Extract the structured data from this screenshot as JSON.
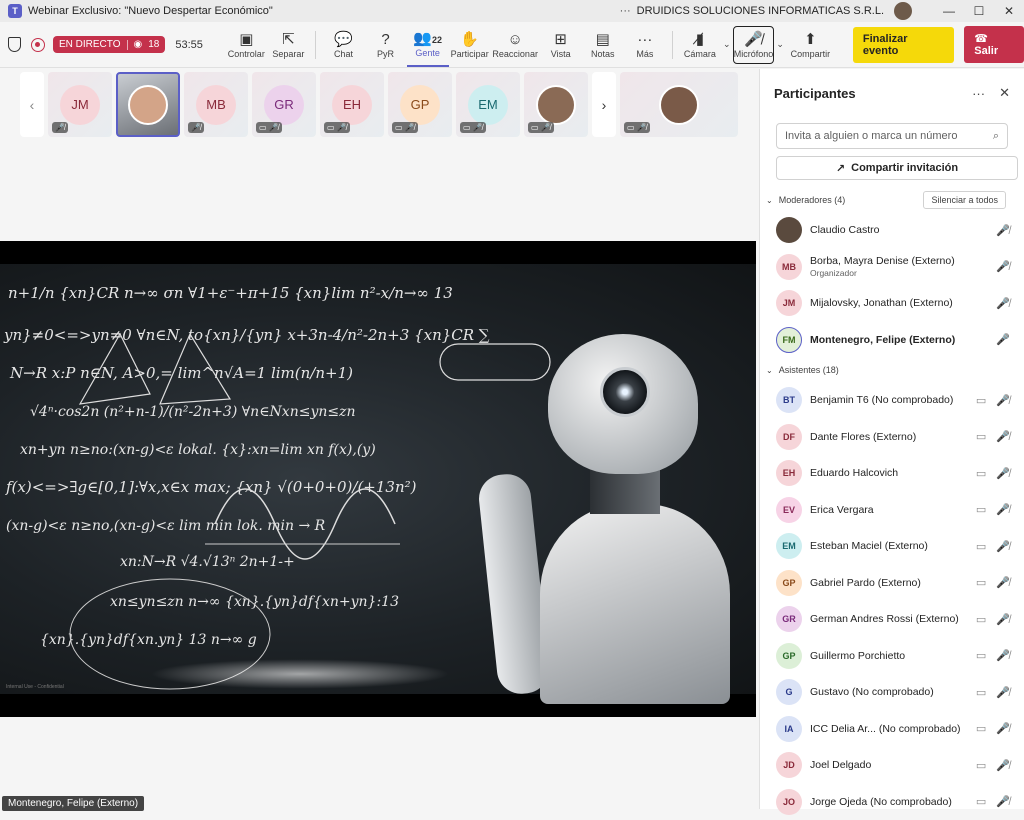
{
  "window": {
    "title": "Webinar Exclusivo: \"Nuevo Despertar Económico\"",
    "more": "···",
    "org": "DRUIDICS SOLUCIONES INFORMATICAS S.R.L.",
    "minimize": "—",
    "maximize": "☐",
    "close": "✕"
  },
  "toolbar": {
    "live_label": "EN DIRECTO",
    "viewers": "18",
    "timer": "53:55",
    "buttons": [
      {
        "label": "Controlar",
        "icon": "▣"
      },
      {
        "label": "Separar",
        "icon": "⇱"
      },
      {
        "label": "Chat",
        "icon": "💬"
      },
      {
        "label": "PyR",
        "icon": "?"
      },
      {
        "label": "Gente",
        "icon": "👥",
        "count": "22"
      },
      {
        "label": "Participar",
        "icon": "✋"
      },
      {
        "label": "Reaccionar",
        "icon": "☺"
      },
      {
        "label": "Vista",
        "icon": "⊞"
      },
      {
        "label": "Notas",
        "icon": "▤"
      },
      {
        "label": "Más",
        "icon": "···"
      }
    ],
    "camera_label": "Cámara",
    "mic_label": "Micrófono",
    "share_label": "Compartir",
    "end_event": "Finalizar evento",
    "leave": "Salir"
  },
  "gallery": [
    {
      "initials": "JM",
      "color": "#f6d5d9",
      "fg": "#8a2a3a",
      "mics": "🎤̸"
    },
    {
      "initials": "",
      "video": true,
      "mics": ""
    },
    {
      "initials": "MB",
      "color": "#f6d5d9",
      "fg": "#8a2a3a",
      "mics": "🎤̸"
    },
    {
      "initials": "GR",
      "color": "#ecd2ec",
      "fg": "#7a2a7a",
      "mics": "▭ 🎤̸"
    },
    {
      "initials": "EH",
      "color": "#f6d5d9",
      "fg": "#8a2a3a",
      "mics": "▭ 🎤̸"
    },
    {
      "initials": "GP",
      "color": "#fde2c8",
      "fg": "#8a4a1a",
      "mics": "▭ 🎤̸"
    },
    {
      "initials": "EM",
      "color": "#cdeef0",
      "fg": "#1a6a70",
      "mics": "▭ 🎤̸"
    },
    {
      "initials": "",
      "video": true,
      "mics": "▭ 🎤̸"
    }
  ],
  "gallery_overflow_mics": "▭ 🎤̸",
  "stage": {
    "internal_label": "Internal Use - Confidential",
    "presenter_badge": "Montenegro, Felipe (Externo)"
  },
  "equations": [
    "n+1/n  {xn}CR  n→∞ σn  ∀1+ε⁻+π+15  {xn}lim n²-x/n→∞ 13",
    "yn}≠0<=>yn≠0  ∀n∈N, to{xn}/{yn}  x+3n-4/n²-2n+3  {xn}CR  ∑",
    "N→R x:P  n∈N, A>0,=  lim^n√A=1  lim(n/n+1)",
    "√4ⁿ·cos2n  (n²+n-1)/(n²-2n+3)  ∀n∈Nxn≤yn≤zn",
    "xn+yn  n≥no:(xn-g)<ε  lokal.  {x}:xn=lim xn  f(x),(y)",
    "f(x)<=>∃g∈[0,1]:∀x,x∈x  max;  {xn}  √(0+0+0)/(+13n²)",
    "(xn-g)<ε n≥no,(xn-g)<ε  lim min  lok. min  → R",
    "xn:N→R  √4.√13ⁿ  2n+1-+",
    "xn≤yn≤zn  n→∞  {xn}.{yn}df{xn+yn}:13",
    "{xn}.{yn}df{xn.yn}  13  n→∞  g"
  ],
  "panel": {
    "title": "Participantes",
    "more": "···",
    "close": "✕",
    "search_placeholder": "Invita a alguien o marca un número",
    "invite_label": "Compartir invitación",
    "moderators_label": "Moderadores (4)",
    "silence_all": "Silenciar a todos",
    "attendees_label": "Asistentes (18)",
    "moderators": [
      {
        "name": "Claudio Castro",
        "initials": "",
        "photo": true,
        "icons": "🎤̸"
      },
      {
        "name": "Borba, Mayra Denise (Externo)",
        "role": "Organizador",
        "initials": "MB",
        "color": "#f6d5d9",
        "fg": "#8a2a3a",
        "icons": "🎤̸"
      },
      {
        "name": "Mijalovsky, Jonathan (Externo)",
        "initials": "JM",
        "color": "#f6d5d9",
        "fg": "#8a2a3a",
        "icons": "🎤̸"
      },
      {
        "name": "Montenegro, Felipe (Externo)",
        "initials": "FM",
        "color": "#e3f0d8",
        "fg": "#3a6a1a",
        "icons": "🎤",
        "bold": true
      }
    ],
    "attendees": [
      {
        "name": "Benjamin T6 (No comprobado)",
        "initials": "BT",
        "color": "#dbe3f6",
        "fg": "#2a3a8a"
      },
      {
        "name": "Dante Flores (Externo)",
        "initials": "DF",
        "color": "#f6d5d9",
        "fg": "#8a2a3a"
      },
      {
        "name": "Eduardo Halcovich",
        "initials": "EH",
        "color": "#f6d5d9",
        "fg": "#8a2a3a"
      },
      {
        "name": "Erica Vergara",
        "initials": "EV",
        "color": "#f7d3e6",
        "fg": "#8a2a5a"
      },
      {
        "name": "Esteban Maciel (Externo)",
        "initials": "EM",
        "color": "#cdeef0",
        "fg": "#1a6a70"
      },
      {
        "name": "Gabriel Pardo (Externo)",
        "initials": "GP",
        "color": "#fde2c8",
        "fg": "#8a4a1a"
      },
      {
        "name": "German Andres Rossi (Externo)",
        "initials": "GR",
        "color": "#ecd2ec",
        "fg": "#7a2a7a"
      },
      {
        "name": "Guillermo Porchietto",
        "initials": "GP",
        "color": "#dcefd7",
        "fg": "#2a6a2a"
      },
      {
        "name": "Gustavo (No comprobado)",
        "initials": "G",
        "color": "#dbe3f6",
        "fg": "#2a3a8a"
      },
      {
        "name": "ICC Delia Ar...  (No comprobado)",
        "initials": "IA",
        "color": "#dbe3f6",
        "fg": "#2a3a8a"
      },
      {
        "name": "Joel Delgado",
        "initials": "JD",
        "color": "#f6d5d9",
        "fg": "#8a2a3a"
      },
      {
        "name": "Jorge Ojeda (No comprobado)",
        "initials": "JO",
        "color": "#f6d5d9",
        "fg": "#8a2a3a"
      }
    ],
    "attendee_icons": [
      "▭",
      "🎤̸"
    ]
  }
}
